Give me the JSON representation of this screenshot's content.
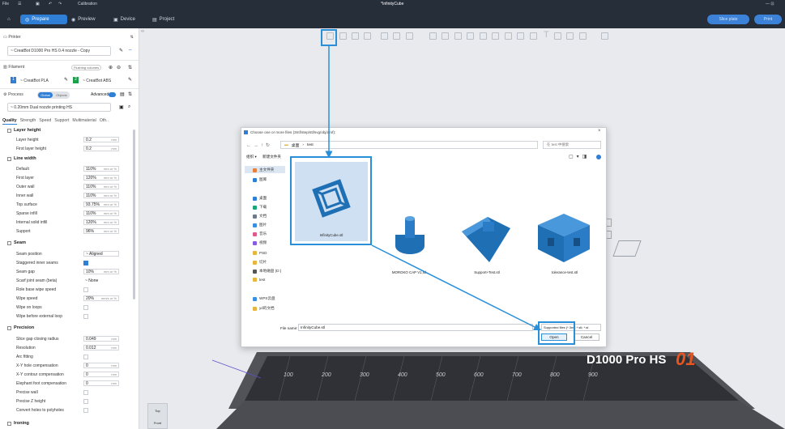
{
  "window": {
    "menu": "File",
    "calibration": "Calibration",
    "title": "*InfinityCube",
    "controls": "— ⊡"
  },
  "tabs": {
    "prepare": "Prepare",
    "preview": "Preview",
    "device": "Device",
    "project": "Project"
  },
  "header_buttons": {
    "slice": "Slice plate",
    "print": "Print"
  },
  "printer": {
    "section": "Printer",
    "selected": "~ CreatBot D1000 Pro HS 0.4 nozzle - Copy"
  },
  "filament": {
    "section": "Filament",
    "flushing": "Flushing volumes",
    "slot1_num": "1",
    "slot1": "~ CreatBot PLA",
    "slot2_num": "2",
    "slot2": "~ CreatBot ABS"
  },
  "process": {
    "section": "Process",
    "global": "Global",
    "objects": "Objects",
    "advanced": "Advanced",
    "selected": "~ 0.20mm Dual nozzle printing HS"
  },
  "quality_tabs": [
    "Quality",
    "Strength",
    "Speed",
    "Support",
    "Multimaterial",
    "Oth.."
  ],
  "groups": {
    "layer_height": "Layer height",
    "line_width": "Line width",
    "seam": "Seam",
    "precision": "Precision",
    "ironing": "Ironing"
  },
  "layer_height_rows": [
    {
      "label": "Layer height",
      "value": "0.2",
      "unit": "mm"
    },
    {
      "label": "First layer height",
      "value": "0.2",
      "unit": "mm"
    }
  ],
  "line_width_rows": [
    {
      "label": "Default",
      "value": "110%",
      "unit": "mm or %"
    },
    {
      "label": "First layer",
      "value": "120%",
      "unit": "mm or %"
    },
    {
      "label": "Outer wall",
      "value": "110%",
      "unit": "mm or %"
    },
    {
      "label": "Inner wall",
      "value": "110%",
      "unit": "mm or %"
    },
    {
      "label": "Top surface",
      "value": "93.75%",
      "unit": "mm or %"
    },
    {
      "label": "Sparse infill",
      "value": "110%",
      "unit": "mm or %"
    },
    {
      "label": "Internal solid infill",
      "value": "120%",
      "unit": "mm or %"
    },
    {
      "label": "Support",
      "value": "96%",
      "unit": "mm or %"
    }
  ],
  "seam": {
    "position_label": "Seam position",
    "position_value": "~ Aligned",
    "staggered_label": "Staggered inner seams",
    "gap_label": "Seam gap",
    "gap_value": "10%",
    "gap_unit": "mm or %",
    "scarf_label": "Scarf joint seam (beta)",
    "scarf_value": "~ None",
    "role_label": "Role base wipe speed",
    "wipe_speed_label": "Wipe speed",
    "wipe_speed_value": "20%",
    "wipe_speed_unit": "mm/s or %",
    "wipe_loops_label": "Wipe on loops",
    "wipe_before_label": "Wipe before external loop"
  },
  "precision": {
    "slice_gap_label": "Slice gap closing radius",
    "slice_gap_value": "0.049",
    "slice_gap_unit": "mm",
    "resolution_label": "Resolution",
    "resolution_value": "0.012",
    "resolution_unit": "mm",
    "arc_label": "Arc fitting",
    "xy_hole_label": "X-Y hole compensation",
    "xy_hole_value": "0",
    "xy_hole_unit": "mm",
    "xy_contour_label": "X-Y contour compensation",
    "xy_contour_value": "0",
    "xy_contour_unit": "mm",
    "elephant_label": "Elephant foot compensation",
    "elephant_value": "0",
    "elephant_unit": "mm",
    "precise_wall_label": "Precise wall",
    "precise_z_label": "Precise Z height",
    "convert_holes_label": "Convert holes to polyholes"
  },
  "bed": {
    "model": "D1000 Pro HS",
    "number": "01",
    "ticks": [
      "100",
      "200",
      "300",
      "400",
      "500",
      "600",
      "700",
      "800",
      "900"
    ]
  },
  "view_cube": {
    "top": "Top",
    "front": "Front"
  },
  "dialog": {
    "title": "Choose one or more files (3mf/step/stl/svg/obj/amf):",
    "path_root": "桌面",
    "path_leaf": "test",
    "search": "在 test 中搜索",
    "organize": "组织 ▾",
    "new_folder": "新建文件夹",
    "nav": [
      "主文件夹",
      "图库",
      "桌面",
      "下载",
      "文档",
      "图片",
      "音乐",
      "视频",
      "PSD",
      "切片",
      "本地磁盘 (D:)",
      "test",
      "WPS云盘",
      "yd的文档"
    ],
    "files": [
      {
        "name": "InfinityCube.stl"
      },
      {
        "name": "MOROKO CAP V1.stl"
      },
      {
        "name": "Support+Test.stl"
      },
      {
        "name": "tolerance-test.stl"
      }
    ],
    "filename_label": "File name:",
    "filename_value": "InfinityCube.stl",
    "filter": "Supported files (*.3mf; *.stl; *.st",
    "open": "Open",
    "cancel": "Cancel"
  },
  "colors": {
    "accent": "#2f7fd7",
    "highlight": "#2a8fd9",
    "model": "#1f6fb5",
    "titlebar": "#262e3a"
  }
}
